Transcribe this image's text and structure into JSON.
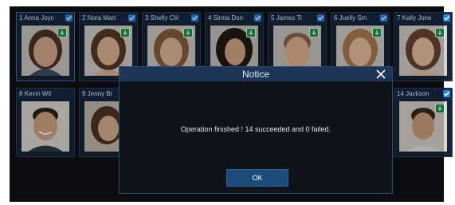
{
  "cards": [
    {
      "name": "1 Anna Joyc"
    },
    {
      "name": "2 Nora Mart"
    },
    {
      "name": "3 Shelly Clir"
    },
    {
      "name": "4 Sinna Don"
    },
    {
      "name": "5 James Ti"
    },
    {
      "name": "6 Juelly Sm"
    },
    {
      "name": "7 Kally Jone"
    },
    {
      "name": "8 Kevin Wil"
    },
    {
      "name": "9 Jenny Br"
    },
    {
      "name": "14 Jackson"
    }
  ],
  "dialog": {
    "title": "Notice",
    "message": "Operation finished ! 14 succeeded and 0 failed.",
    "ok_label": "OK"
  },
  "colors": {
    "card_header": "#152945",
    "checkbox": "#2a86e8",
    "sync_badge": "#1a9b4d",
    "dialog_header": "#1d3556",
    "ok_button": "#1b4c7a"
  },
  "icons": {
    "checkbox": "checkbox-checked-icon",
    "sync": "sync-icon",
    "close": "close-icon"
  }
}
